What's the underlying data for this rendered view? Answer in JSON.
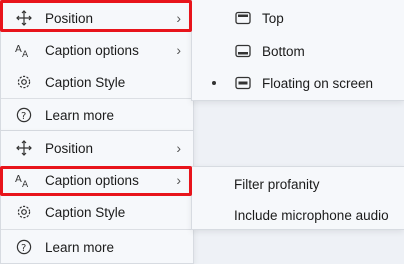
{
  "top_menu": {
    "items": [
      {
        "label": "Position",
        "icon": "move-icon",
        "submenu": true
      },
      {
        "label": "Caption options",
        "icon": "caption-aa-icon",
        "submenu": true
      },
      {
        "label": "Caption Style",
        "icon": "gear-icon",
        "submenu": false
      },
      {
        "label": "Learn more",
        "icon": "question-circle-icon",
        "submenu": false
      }
    ]
  },
  "position_submenu": {
    "items": [
      {
        "label": "Top",
        "icon": "top-window-icon",
        "selected": false
      },
      {
        "label": "Bottom",
        "icon": "bottom-window-icon",
        "selected": false
      },
      {
        "label": "Floating on screen",
        "icon": "floating-window-icon",
        "selected": true
      }
    ]
  },
  "bottom_menu": {
    "items": [
      {
        "label": "Position",
        "icon": "move-icon",
        "submenu": true
      },
      {
        "label": "Caption options",
        "icon": "caption-aa-icon",
        "submenu": true
      },
      {
        "label": "Caption Style",
        "icon": "gear-icon",
        "submenu": false
      },
      {
        "label": "Learn more",
        "icon": "question-circle-icon",
        "submenu": false
      }
    ]
  },
  "caption_options_submenu": {
    "items": [
      {
        "label": "Filter profanity"
      },
      {
        "label": "Include microphone audio"
      }
    ]
  },
  "chevron": "›",
  "colors": {
    "highlight_border": "#e8141b",
    "menu_bg": "#f6f8fb"
  }
}
